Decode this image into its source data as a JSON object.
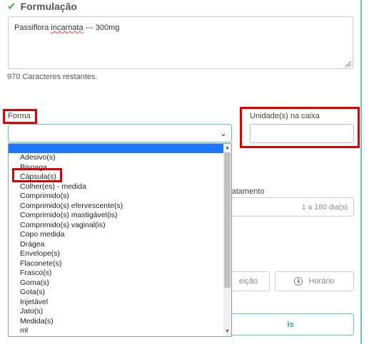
{
  "section": {
    "title": "Formulação",
    "icon": "check-icon"
  },
  "formula": {
    "text_before": "Passiflora ",
    "text_misspelled": "incarnata",
    "text_after": " --- 300mg",
    "remaining": "970 Caracteres restantes."
  },
  "forma": {
    "label": "Forma",
    "selected_value": ""
  },
  "unidade": {
    "label": "Unidade(s) na caixa",
    "value": ""
  },
  "dropdown_options": [
    "Adesivo(s)",
    "Bisnaga",
    "Cápsula(s)",
    "Colher(es) - medida",
    "Comprimido(s)",
    "Comprimido(s) efervescente(s)",
    "Comprimido(s) mastigável(is)",
    "Comprimido(s) vaginal(is)",
    "Copo medida",
    "Drágea",
    "Envelope(s)",
    "Flaconete(s)",
    "Frasco(s)",
    "Goma(s)",
    "Gota(s)",
    "Injetável",
    "Jato(s)",
    "Medida(s)",
    "ml"
  ],
  "tratamento": {
    "label_partial": "tratamento",
    "placeholder": "1 a 180 dia(s)"
  },
  "buttons": {
    "refeicao_partial": "eição",
    "horario": "Horário",
    "bottom_partial": "is"
  },
  "colors": {
    "teal": "#5fc5c5",
    "highlight_red": "#e00000",
    "selected_blue": "#1e78ff"
  }
}
